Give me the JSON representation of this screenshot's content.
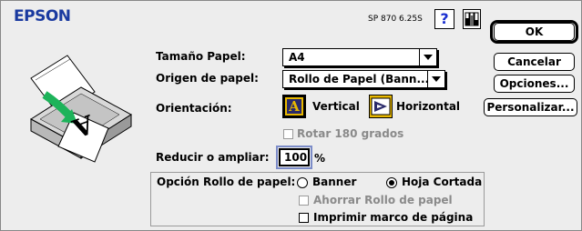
{
  "header": {
    "brand": "EPSON",
    "version": "SP 870 6.25S",
    "help_glyph": "?"
  },
  "buttons": {
    "ok": "OK",
    "cancel": "Cancelar",
    "options": "Opciones...",
    "customize": "Personalizar..."
  },
  "paper_size": {
    "label": "Tamaño Papel:",
    "value": "A4"
  },
  "paper_source": {
    "label": "Origen de papel:",
    "value": "Rollo de Papel (Bann..."
  },
  "orientation": {
    "label": "Orientación:",
    "vertical": "Vertical",
    "horizontal": "Horizontal",
    "selected": "vertical",
    "icon_letter": "A"
  },
  "rotate": {
    "label": "Rotar 180 grados",
    "checked": false,
    "enabled": false
  },
  "scale": {
    "label": "Reducir o ampliar:",
    "value": "100",
    "unit": "%"
  },
  "roll_option": {
    "label": "Opción Rollo de papel:",
    "banner": "Banner",
    "cut_sheet": "Hoja Cortada",
    "selected": "cut_sheet",
    "save_roll": "Ahorrar Rollo de papel",
    "save_roll_enabled": false,
    "print_frame": "Imprimir marco de página",
    "print_frame_checked": false
  },
  "preview": {
    "sheet_letter": "A"
  },
  "colors": {
    "brand_blue": "#1a3aa0",
    "help_blue": "#1a2fd0",
    "arrow_green": "#1db35a",
    "icon_yellow": "#e8b800"
  }
}
